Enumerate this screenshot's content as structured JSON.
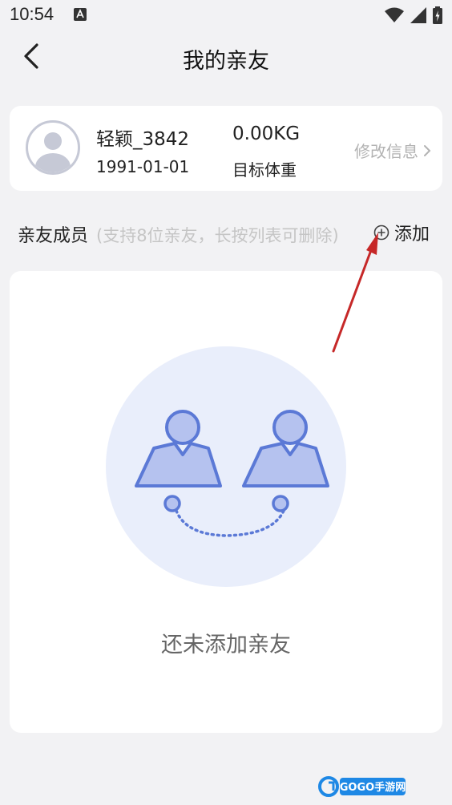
{
  "status_bar": {
    "time": "10:54"
  },
  "nav": {
    "title": "我的亲友"
  },
  "profile": {
    "username": "轻颖_3842",
    "birthdate": "1991-01-01",
    "target_weight": "0.00KG",
    "target_weight_label": "目标体重",
    "edit_label": "修改信息"
  },
  "members": {
    "title": "亲友成员",
    "hint": "(支持8位亲友，长按列表可删除)",
    "add_label": "添加"
  },
  "empty_state": {
    "message": "还未添加亲友"
  },
  "watermark": {
    "text": "GOGO手游网"
  },
  "colors": {
    "accent": "#5b79d6",
    "illustration_bg": "#e9eefb",
    "figure_fill": "#b5c2ef",
    "arrow": "#c62828",
    "watermark": "#1e88e5"
  }
}
